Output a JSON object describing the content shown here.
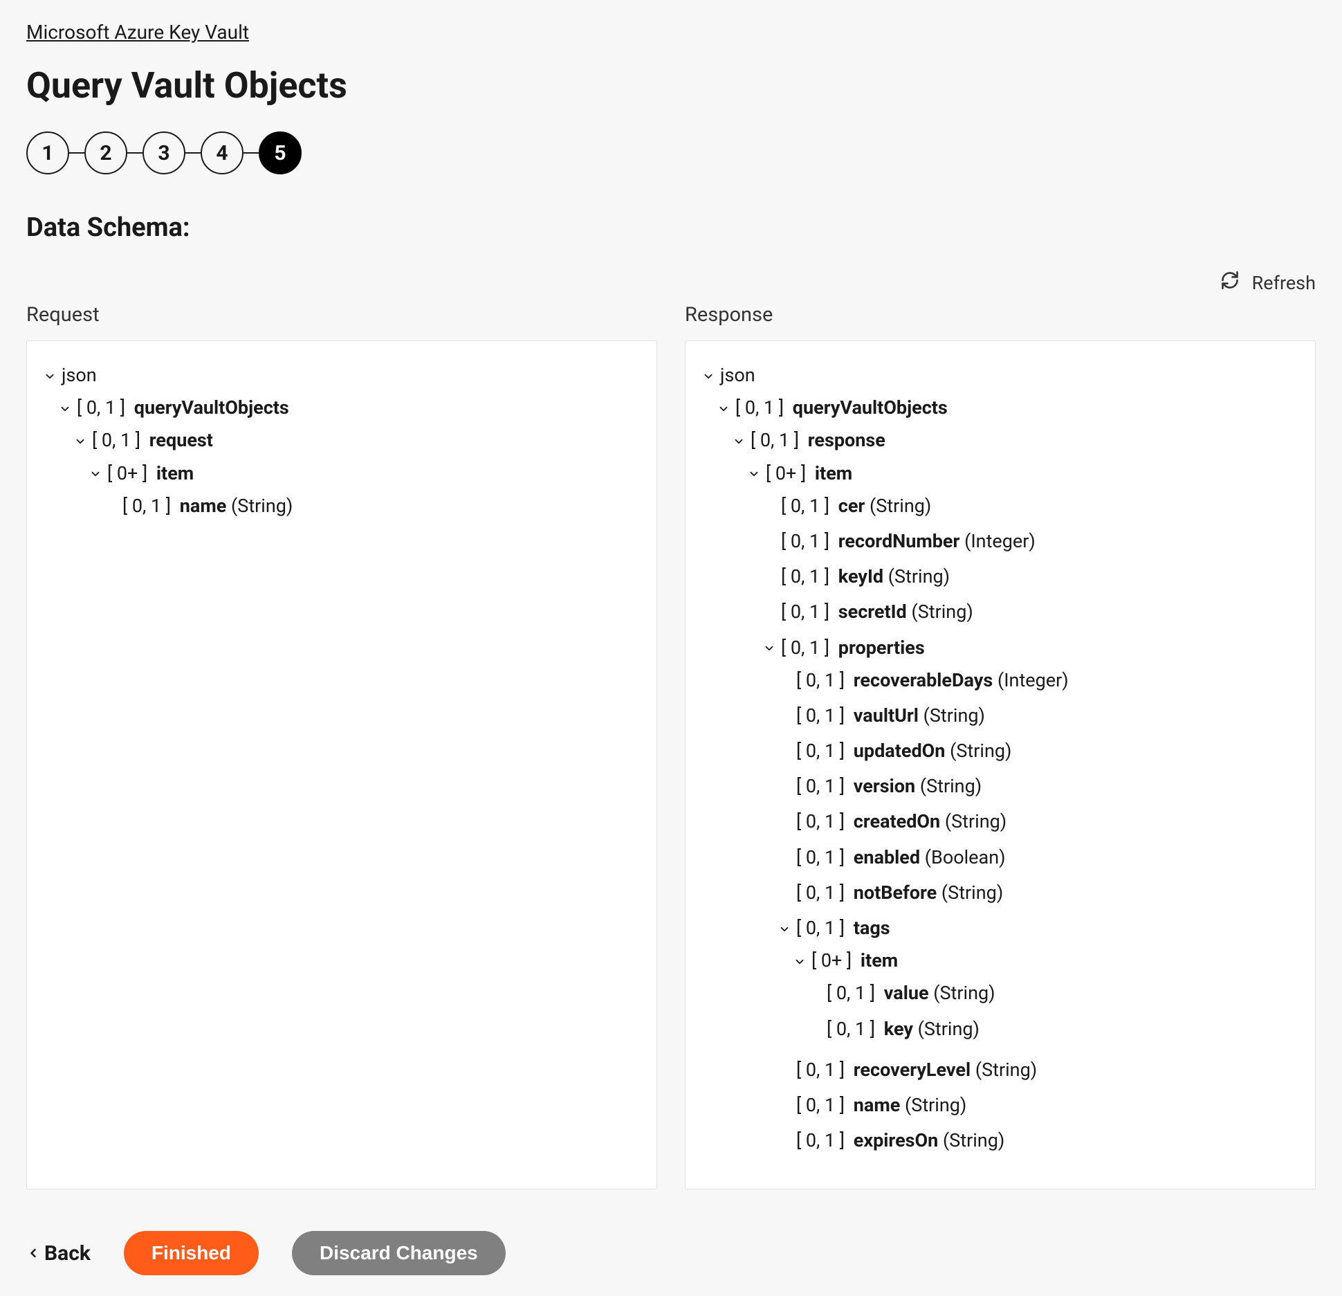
{
  "breadcrumb": "Microsoft Azure Key Vault",
  "page_title": "Query Vault Objects",
  "stepper": {
    "steps": [
      "1",
      "2",
      "3",
      "4",
      "5"
    ],
    "active": 5
  },
  "section_title": "Data Schema:",
  "refresh_label": "Refresh",
  "request_label": "Request",
  "response_label": "Response",
  "footer": {
    "back": "Back",
    "finished": "Finished",
    "discard": "Discard Changes"
  },
  "request_tree": {
    "name": "json",
    "children": [
      {
        "cardinality": "[ 0, 1 ]",
        "name": "queryVaultObjects",
        "children": [
          {
            "cardinality": "[ 0, 1 ]",
            "name": "request",
            "children": [
              {
                "cardinality": "[ 0+ ]",
                "name": "item",
                "children": [
                  {
                    "cardinality": "[ 0, 1 ]",
                    "name": "name",
                    "type": "(String)"
                  }
                ]
              }
            ]
          }
        ]
      }
    ]
  },
  "response_tree": {
    "name": "json",
    "children": [
      {
        "cardinality": "[ 0, 1 ]",
        "name": "queryVaultObjects",
        "children": [
          {
            "cardinality": "[ 0, 1 ]",
            "name": "response",
            "children": [
              {
                "cardinality": "[ 0+ ]",
                "name": "item",
                "children": [
                  {
                    "cardinality": "[ 0, 1 ]",
                    "name": "cer",
                    "type": "(String)"
                  },
                  {
                    "cardinality": "[ 0, 1 ]",
                    "name": "recordNumber",
                    "type": "(Integer)"
                  },
                  {
                    "cardinality": "[ 0, 1 ]",
                    "name": "keyId",
                    "type": "(String)"
                  },
                  {
                    "cardinality": "[ 0, 1 ]",
                    "name": "secretId",
                    "type": "(String)"
                  },
                  {
                    "cardinality": "[ 0, 1 ]",
                    "name": "properties",
                    "children": [
                      {
                        "cardinality": "[ 0, 1 ]",
                        "name": "recoverableDays",
                        "type": "(Integer)"
                      },
                      {
                        "cardinality": "[ 0, 1 ]",
                        "name": "vaultUrl",
                        "type": "(String)"
                      },
                      {
                        "cardinality": "[ 0, 1 ]",
                        "name": "updatedOn",
                        "type": "(String)"
                      },
                      {
                        "cardinality": "[ 0, 1 ]",
                        "name": "version",
                        "type": "(String)"
                      },
                      {
                        "cardinality": "[ 0, 1 ]",
                        "name": "createdOn",
                        "type": "(String)"
                      },
                      {
                        "cardinality": "[ 0, 1 ]",
                        "name": "enabled",
                        "type": "(Boolean)"
                      },
                      {
                        "cardinality": "[ 0, 1 ]",
                        "name": "notBefore",
                        "type": "(String)"
                      },
                      {
                        "cardinality": "[ 0, 1 ]",
                        "name": "tags",
                        "children": [
                          {
                            "cardinality": "[ 0+ ]",
                            "name": "item",
                            "children": [
                              {
                                "cardinality": "[ 0, 1 ]",
                                "name": "value",
                                "type": "(String)"
                              },
                              {
                                "cardinality": "[ 0, 1 ]",
                                "name": "key",
                                "type": "(String)"
                              }
                            ]
                          }
                        ]
                      },
                      {
                        "cardinality": "[ 0, 1 ]",
                        "name": "recoveryLevel",
                        "type": "(String)"
                      },
                      {
                        "cardinality": "[ 0, 1 ]",
                        "name": "name",
                        "type": "(String)"
                      },
                      {
                        "cardinality": "[ 0, 1 ]",
                        "name": "expiresOn",
                        "type": "(String)"
                      }
                    ]
                  }
                ]
              }
            ]
          }
        ]
      }
    ]
  }
}
